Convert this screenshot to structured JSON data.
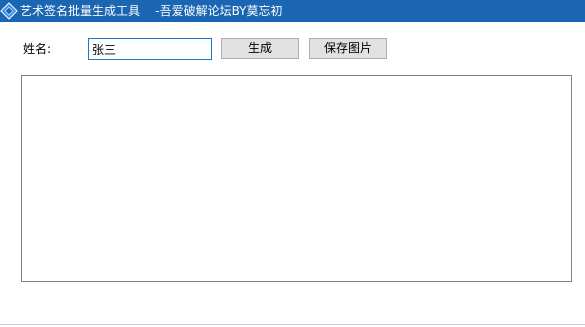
{
  "window": {
    "title": "艺术签名批量生成工具    -吾爱破解论坛BY莫忘初",
    "titlebar_color": "#1a66b3",
    "icon": "diamond-app-icon"
  },
  "form": {
    "name_label": "姓名:",
    "name_value": "张三",
    "generate_label": "生成",
    "save_label": "保存图片"
  },
  "preview": {
    "content": ""
  }
}
